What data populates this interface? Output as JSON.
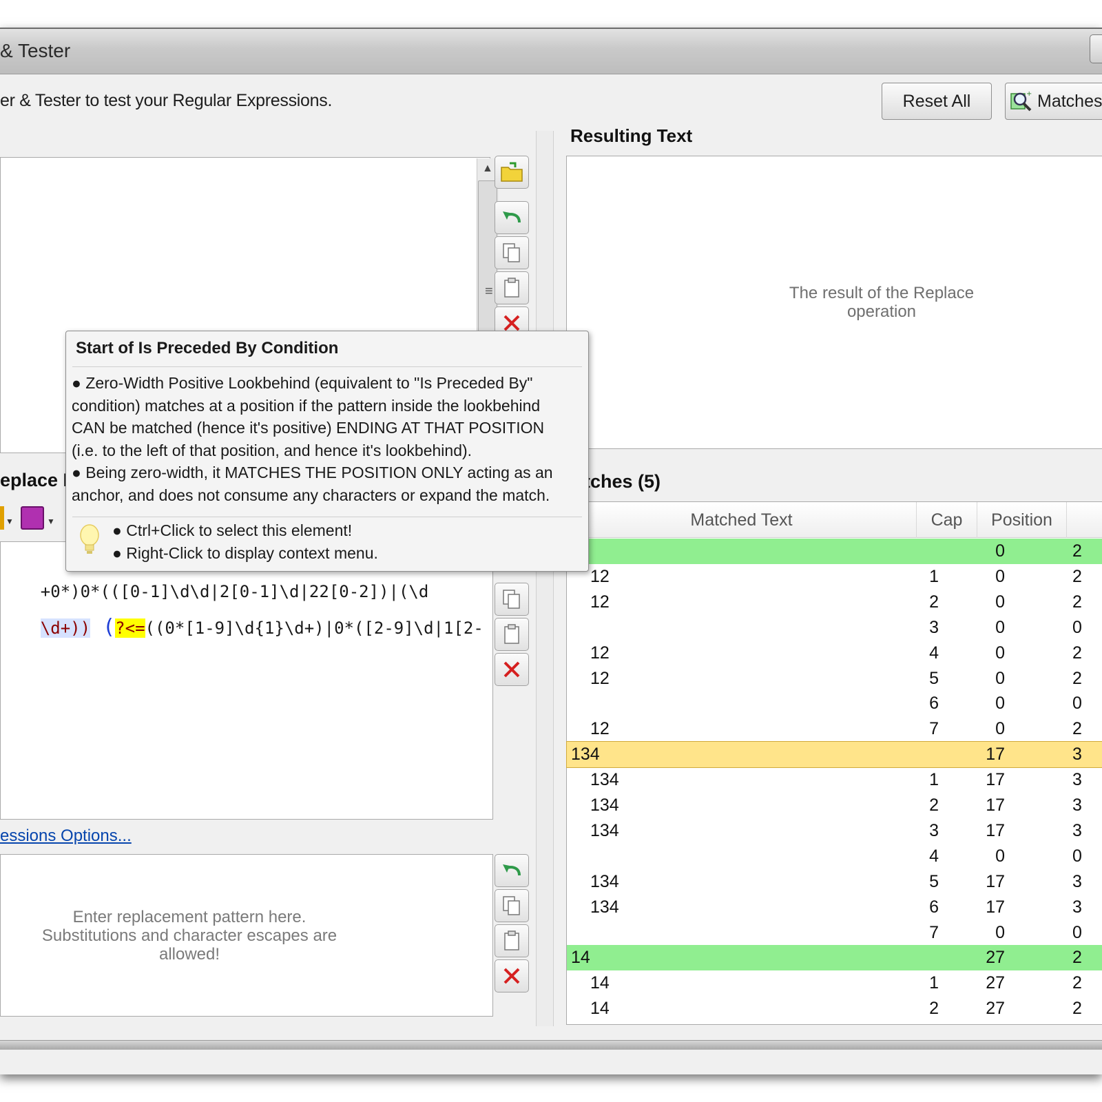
{
  "window": {
    "title": "& Tester"
  },
  "description": "er & Tester to test your Regular Expressions.",
  "toolbar": {
    "reset_label": "Reset All",
    "matches_label": "Matches"
  },
  "input_panel": {},
  "replace_panel": {
    "header": "eplace I",
    "regex_line1": "+0*)0*(([0-1]\\d\\d|2[0-1]\\d|22[0-2])|(\\d",
    "regex_line2_pre": "\\d+))",
    "regex_line2_lookbehind": "?<=",
    "regex_line2_post": "((0*[1-9]\\d{1}\\d+)|0*([2-9]\\d|1[2-",
    "options_link": "essions Options...",
    "replacement_placeholder": "Enter replacement pattern here.\nSubstitutions and character escapes are\nallowed!"
  },
  "result_panel": {
    "header": "Resulting Text",
    "placeholder": "The result of the Replace\noperation"
  },
  "matches_panel": {
    "header": "tches (5)",
    "columns": [
      "Matched Text",
      "Cap",
      "Position"
    ],
    "rows": [
      {
        "text": "",
        "cap": "",
        "pos": "0",
        "len": "2",
        "kind": "match"
      },
      {
        "text": "12",
        "cap": "1",
        "pos": "0",
        "len": "2",
        "kind": "group"
      },
      {
        "text": "12",
        "cap": "2",
        "pos": "0",
        "len": "2",
        "kind": "group"
      },
      {
        "text": "",
        "cap": "3",
        "pos": "0",
        "len": "0",
        "kind": "group"
      },
      {
        "text": "12",
        "cap": "4",
        "pos": "0",
        "len": "2",
        "kind": "group"
      },
      {
        "text": "12",
        "cap": "5",
        "pos": "0",
        "len": "2",
        "kind": "group"
      },
      {
        "text": "",
        "cap": "6",
        "pos": "0",
        "len": "0",
        "kind": "group"
      },
      {
        "text": "12",
        "cap": "7",
        "pos": "0",
        "len": "2",
        "kind": "group"
      },
      {
        "text": "134",
        "cap": "",
        "pos": "17",
        "len": "3",
        "kind": "selected"
      },
      {
        "text": "134",
        "cap": "1",
        "pos": "17",
        "len": "3",
        "kind": "group"
      },
      {
        "text": "134",
        "cap": "2",
        "pos": "17",
        "len": "3",
        "kind": "group"
      },
      {
        "text": "134",
        "cap": "3",
        "pos": "17",
        "len": "3",
        "kind": "group"
      },
      {
        "text": "",
        "cap": "4",
        "pos": "0",
        "len": "0",
        "kind": "group"
      },
      {
        "text": "134",
        "cap": "5",
        "pos": "17",
        "len": "3",
        "kind": "group"
      },
      {
        "text": "134",
        "cap": "6",
        "pos": "17",
        "len": "3",
        "kind": "group"
      },
      {
        "text": "",
        "cap": "7",
        "pos": "0",
        "len": "0",
        "kind": "group"
      },
      {
        "text": "14",
        "cap": "",
        "pos": "27",
        "len": "2",
        "kind": "match"
      },
      {
        "text": "14",
        "cap": "1",
        "pos": "27",
        "len": "2",
        "kind": "group"
      },
      {
        "text": "14",
        "cap": "2",
        "pos": "27",
        "len": "2",
        "kind": "group"
      }
    ]
  },
  "tooltip": {
    "title": "Start of Is Preceded By Condition",
    "bullet1_line1": "● Zero-Width Positive Lookbehind (equivalent to \"Is Preceded By\"",
    "bullet1_line2": "condition) matches at a position if the pattern inside the lookbehind",
    "bullet1_line3": " CAN be matched (hence it's positive) ENDING AT THAT POSITION",
    "bullet1_line4": "(i.e. to the left of that position, and hence it's lookbehind).",
    "bullet2_line1": "● Being zero-width, it MATCHES THE POSITION ONLY acting as an",
    "bullet2_line2": "anchor, and does not consume any characters or expand the match.",
    "tip1": "● Ctrl+Click to select this element!",
    "tip2": "● Right-Click to display context menu."
  },
  "colors": {
    "match_row": "#90ee90",
    "selected_row": "#ffe48a",
    "lookbehind_highlight": "#ffff00",
    "group_paren": "#1f3fd6",
    "digit": "#b22222",
    "escape": "#8b0000",
    "quantifier": "#008000"
  }
}
